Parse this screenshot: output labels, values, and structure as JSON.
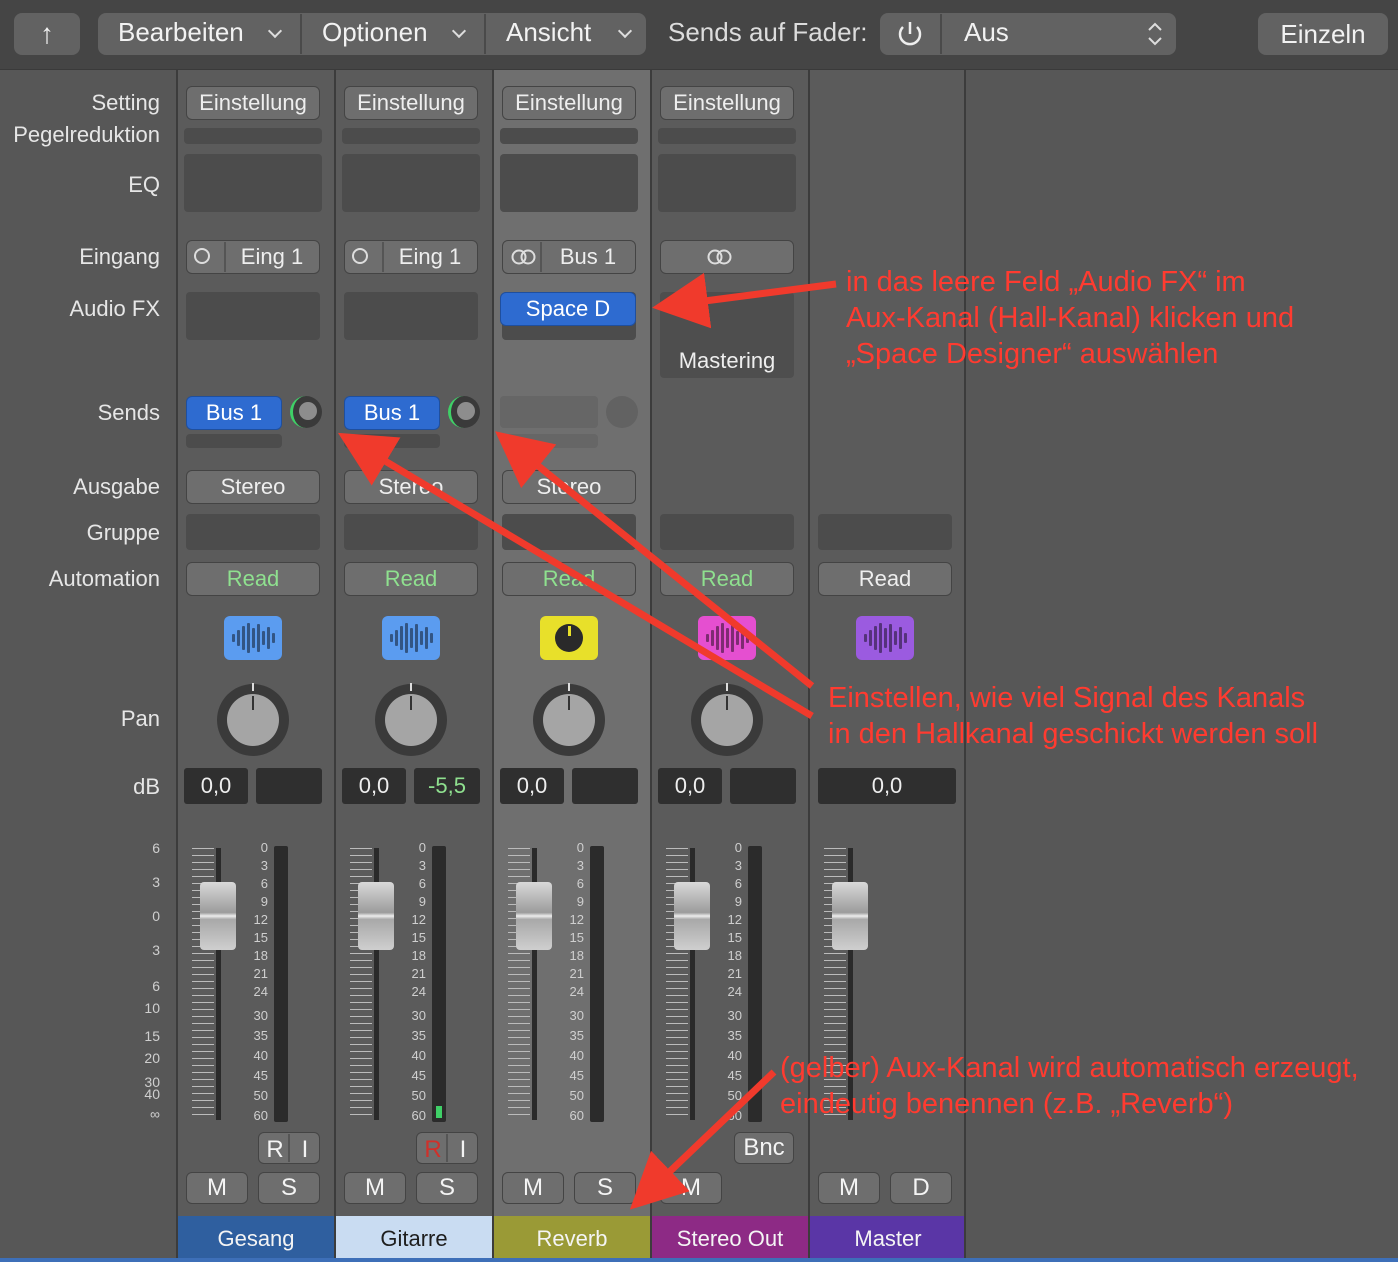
{
  "toolbar": {
    "back_label": "↑",
    "menus": [
      "Bearbeiten",
      "Optionen",
      "Ansicht"
    ],
    "sends_label": "Sends auf Fader:",
    "sends_value": "Aus",
    "single_label": "Einzeln"
  },
  "row_labels": {
    "setting": "Setting",
    "gain": "Pegelreduktion",
    "eq": "EQ",
    "input": "Eingang",
    "audiofx": "Audio FX",
    "sends": "Sends",
    "output": "Ausgabe",
    "group": "Gruppe",
    "automation": "Automation",
    "pan": "Pan",
    "db": "dB"
  },
  "strips": [
    {
      "name": "Gesang",
      "setting": "Einstellung",
      "input": "Eing 1",
      "send": "Bus 1",
      "output": "Stereo",
      "automation": "Read",
      "db": "0,0",
      "peak": "",
      "rec": "R",
      "in": "I",
      "m": "M",
      "s": "S",
      "icon_color": "#5b9cf0",
      "name_color": "#2f5f9f"
    },
    {
      "name": "Gitarre",
      "setting": "Einstellung",
      "input": "Eing 1",
      "send": "Bus 1",
      "output": "Stereo",
      "automation": "Read",
      "db": "0,0",
      "peak": "-5,5",
      "rec": "R",
      "in": "I",
      "m": "M",
      "s": "S",
      "icon_color": "#5b9cf0",
      "name_color": "#c9dcf2"
    },
    {
      "name": "Reverb",
      "setting": "Einstellung",
      "input": "Bus 1",
      "fx": "Space D",
      "output": "Stereo",
      "automation": "Read",
      "db": "0,0",
      "peak": "",
      "m": "M",
      "s": "S",
      "icon_color": "#e8e02a",
      "name_color": "#9a9a36"
    },
    {
      "name": "Stereo Out",
      "setting": "Einstellung",
      "fx": "Mastering",
      "automation": "Read",
      "db": "0,0",
      "peak": "",
      "bnc": "Bnc",
      "m": "M",
      "icon_color": "#e54fd0",
      "name_color": "#8d2a85"
    },
    {
      "name": "Master",
      "automation": "Read",
      "db": "0,0",
      "m": "M",
      "d": "D",
      "icon_color": "#9b5be0",
      "name_color": "#5a36a6"
    }
  ],
  "meter_scale": [
    "0",
    "3",
    "6",
    "9",
    "12",
    "15",
    "18",
    "21",
    "24",
    "30",
    "35",
    "40",
    "45",
    "50",
    "60"
  ],
  "fader_scale": [
    "6",
    "3",
    "0",
    "3",
    "6",
    "10",
    "15",
    "20",
    "30",
    "40",
    "∞"
  ],
  "annotations": {
    "audiofx": [
      "in das leere Feld „Audio FX“ im",
      "Aux-Kanal (Hall-Kanal) klicken und",
      "„Space Designer“ auswählen"
    ],
    "sends": [
      "Einstellen, wie viel Signal des Kanals",
      "in den Hallkanal geschickt werden soll"
    ],
    "aux": [
      "(gelber) Aux-Kanal wird automatisch erzeugt,",
      "eindeutig benennen (z.B. „Reverb“)"
    ]
  },
  "colors": {
    "accent_blue": "#2e6bd0",
    "annotation_red": "#ff3b30",
    "automation_green": "#8fe08f"
  }
}
